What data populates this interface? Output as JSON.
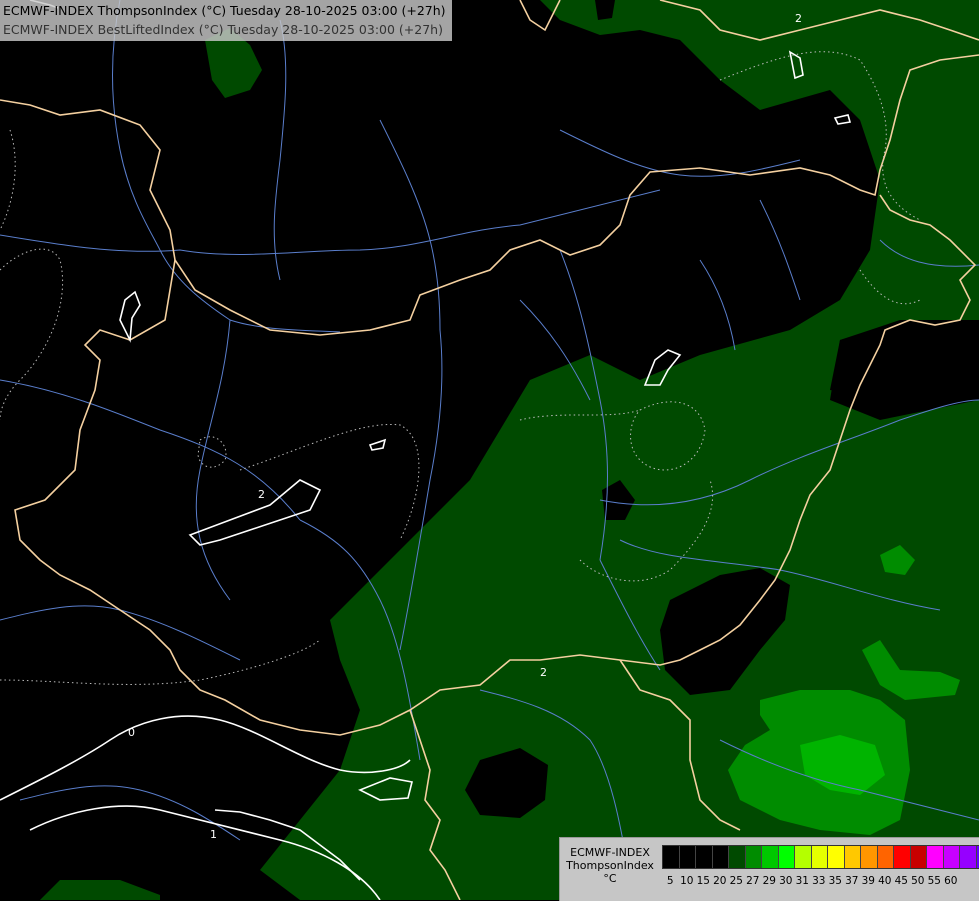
{
  "header": {
    "line1": "ECMWF-INDEX ThompsonIndex (°C) Tuesday 28-10-2025 03:00 (+27h)",
    "line2": "ECMWF-INDEX BestLiftedIndex (°C) Tuesday 28-10-2025 03:00 (+27h)"
  },
  "map": {
    "background_color": "#000000",
    "fill_colors": [
      "#004a00",
      "#007000",
      "#00b400"
    ],
    "border_color": "#f4d0a0",
    "river_color": "#5a7ecc",
    "contour_color": "#ffffff",
    "contour_labels": [
      "2",
      "2",
      "0",
      "1",
      "2"
    ]
  },
  "legend": {
    "title_lines": [
      "ECMWF-INDEX",
      "ThompsonIndex",
      "°C"
    ],
    "colors": [
      "#000000",
      "#000000",
      "#000000",
      "#000000",
      "#004a00",
      "#008c00",
      "#00c800",
      "#00ff00",
      "#b4ff00",
      "#e6ff00",
      "#ffff00",
      "#ffc800",
      "#ff9600",
      "#ff6400",
      "#ff0000",
      "#c80000",
      "#ff00ff",
      "#c800ff",
      "#9600ff",
      "#6400ff",
      "#0000ff"
    ],
    "labels": [
      "5",
      "10",
      "15",
      "20",
      "25",
      "27",
      "29",
      "30",
      "31",
      "33",
      "35",
      "37",
      "39",
      "40",
      "45",
      "50",
      "55",
      "60"
    ]
  }
}
